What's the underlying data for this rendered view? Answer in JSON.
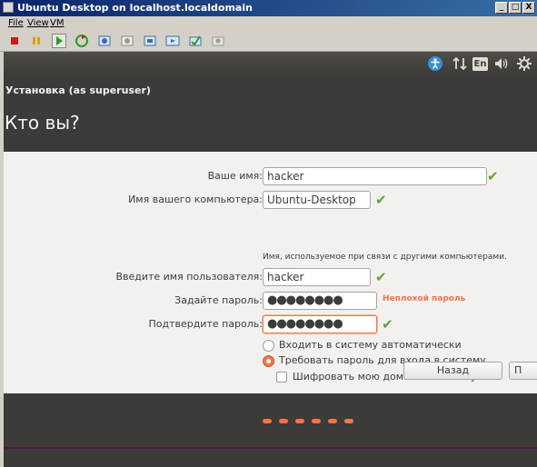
{
  "window": {
    "title": "Ubuntu Desktop on localhost.localdomain",
    "controls": {
      "minimize": "_",
      "maximize": "□",
      "close": "X"
    }
  },
  "menubar": {
    "items": [
      "File",
      "View",
      "VM"
    ]
  },
  "toolbar": {
    "icons": [
      "power-off-icon",
      "pause-icon",
      "play-icon",
      "reset-icon",
      "snapshot-icon",
      "snapshot-restore-icon",
      "snapshot-manager-icon",
      "fullscreen-icon",
      "unity-icon",
      "settings-icon"
    ]
  },
  "topbar": {
    "keyboard_layout": "En",
    "indicators": [
      "accessibility-icon",
      "network-icon",
      "keyboard-layout",
      "volume-icon",
      "power-gear-icon"
    ]
  },
  "installer": {
    "window_title": "Установка (as superuser)",
    "heading": "Кто вы?",
    "fields": {
      "your_name": {
        "label": "Ваше имя:",
        "value": "hacker"
      },
      "computer_name": {
        "label": "Имя вашего компьютера:",
        "value": "Ubuntu-Desktop",
        "hint": "Имя, используемое при связи с другими компьютерами."
      },
      "username": {
        "label": "Введите имя пользователя:",
        "value": "hacker"
      },
      "password": {
        "label": "Задайте пароль:",
        "value": "●●●●●●●●",
        "strength": "Неплохой пароль"
      },
      "confirm_password": {
        "label": "Подтвердите пароль:",
        "value": "●●●●●●●●"
      }
    },
    "login_options": {
      "auto_login": {
        "label": "Входить в систему автоматически",
        "selected": false
      },
      "require_password": {
        "label": "Требовать пароль для входа в систему",
        "selected": true
      },
      "encrypt_home": {
        "label": "Шифровать мою домашнюю папку",
        "checked": false
      }
    },
    "buttons": {
      "back": "Назад",
      "forward": "П"
    },
    "accent_color": "#f07746",
    "ok_color": "#5fa42f"
  },
  "slideshow": {
    "dot_count": 6
  }
}
